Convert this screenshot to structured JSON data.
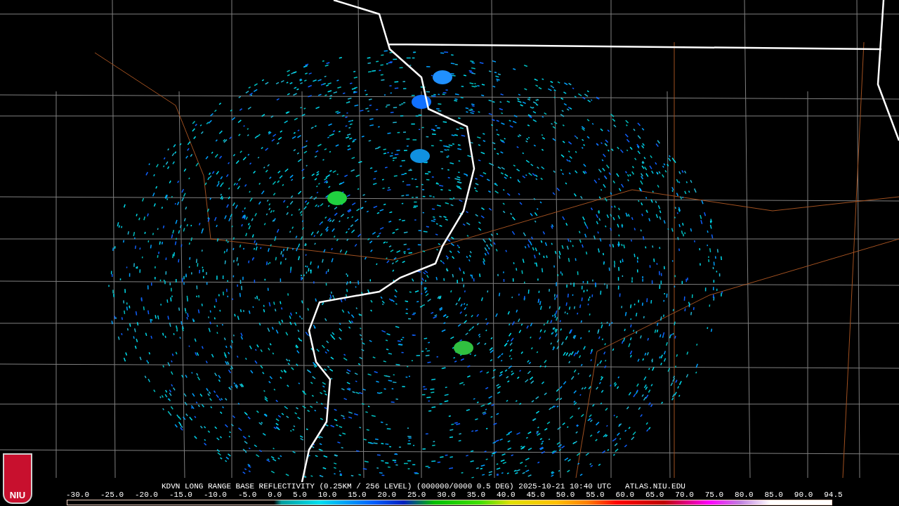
{
  "logo": {
    "text": "NIU"
  },
  "product_line": "KDVN LONG RANGE BASE REFLECTIVITY (0.25KM / 256 LEVEL) (000000/0000 0.5 DEG) 2025-10-21 10:40 UTC   ATLAS.NIU.EDU",
  "scale_labels": [
    "-30.0",
    "-25.0",
    "-20.0",
    "-15.0",
    "-10.0",
    "-5.0",
    "0.0",
    "5.0",
    "10.0",
    "15.0",
    "20.0",
    "25.0",
    "30.0",
    "35.0",
    "40.0",
    "45.0",
    "50.0",
    "55.0",
    "60.0",
    "65.0",
    "70.0",
    "75.0",
    "80.0",
    "85.0",
    "90.0",
    "94.5"
  ]
}
